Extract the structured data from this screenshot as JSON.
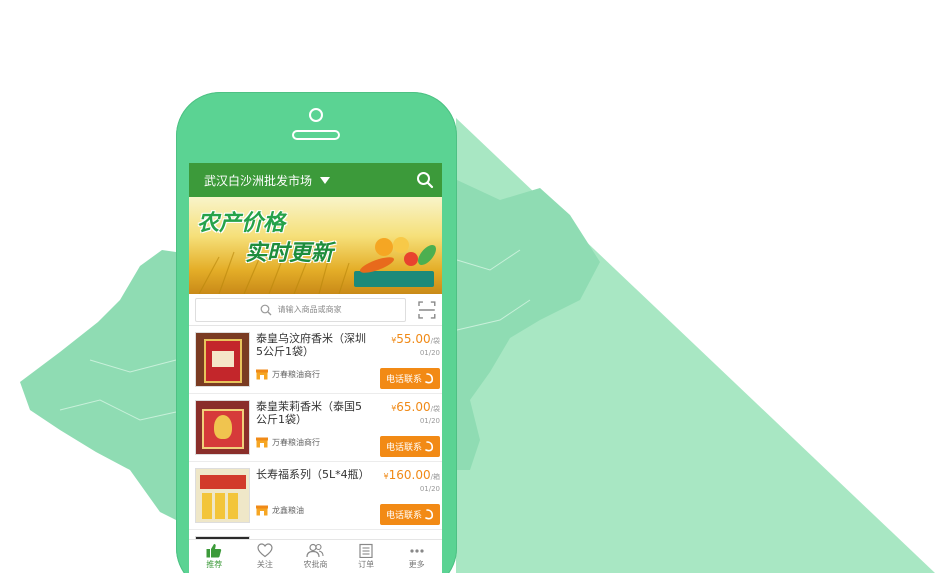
{
  "colors": {
    "brand_green": "#3c9a3a",
    "phone_green": "#5bd393",
    "accent_orange": "#f28a15"
  },
  "header": {
    "market": "武汉白沙洲批发市场"
  },
  "banner": {
    "line1": "农产价格",
    "line2": "实时更新"
  },
  "search": {
    "placeholder": "请输入商品或商家"
  },
  "products": [
    {
      "name": "泰皇乌汶府香米（深圳5公斤1袋）",
      "currency": "¥",
      "price": "55.00",
      "unit": "/袋",
      "date": "01/20",
      "shop": "万春粮油商行",
      "call": "电话联系"
    },
    {
      "name": "泰皇茉莉香米（泰国5公斤1袋）",
      "currency": "¥",
      "price": "65.00",
      "unit": "/袋",
      "date": "01/20",
      "shop": "万春粮油商行",
      "call": "电话联系"
    },
    {
      "name": "长寿福系列（5L*4瓶）",
      "currency": "¥",
      "price": "160.00",
      "unit": "/箱",
      "date": "01/20",
      "shop": "龙鑫粮油",
      "call": "电话联系"
    }
  ],
  "tabs": [
    {
      "label": "推荐",
      "icon": "thumbs-up-icon",
      "active": true
    },
    {
      "label": "关注",
      "icon": "heart-icon",
      "active": false
    },
    {
      "label": "农批商",
      "icon": "users-icon",
      "active": false
    },
    {
      "label": "订单",
      "icon": "order-list-icon",
      "active": false
    },
    {
      "label": "更多",
      "icon": "more-icon",
      "active": false
    }
  ]
}
